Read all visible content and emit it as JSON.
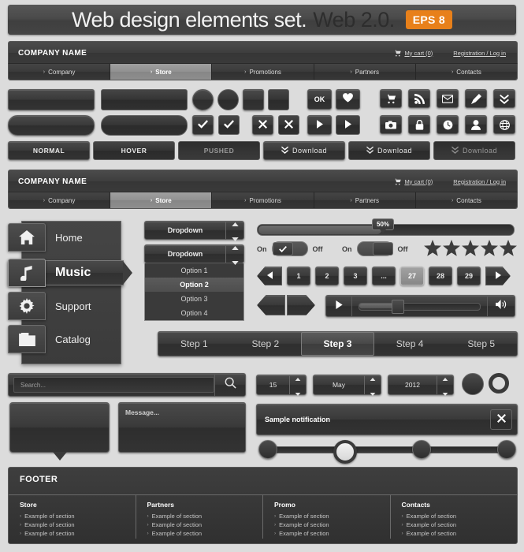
{
  "title_bar": {
    "main": "Web design elements set.",
    "sub": "Web 2.0.",
    "badge": "EPS 8",
    "badge_color": "#e8801a"
  },
  "header": {
    "company": "COMPANY NAME",
    "cart_label": "My cart (0)",
    "auth_label": "Registration / Log in",
    "cart_icon": "cart-icon"
  },
  "nav": {
    "items": [
      {
        "label": "Company",
        "active": false
      },
      {
        "label": "Store",
        "active": true
      },
      {
        "label": "Promotions",
        "active": false
      },
      {
        "label": "Partners",
        "active": false
      },
      {
        "label": "Contacts",
        "active": false
      }
    ],
    "chevron": "›"
  },
  "buttons": {
    "states": [
      {
        "label": "NORMAL",
        "state": "normal"
      },
      {
        "label": "HOVER",
        "state": "hover"
      },
      {
        "label": "PUSHED",
        "state": "pushed"
      }
    ],
    "download": [
      {
        "label": "Download",
        "state": "normal"
      },
      {
        "label": "Download",
        "state": "hover"
      },
      {
        "label": "Download",
        "state": "pushed"
      }
    ],
    "ok_label": "OK",
    "icons_row1": [
      "cart-icon",
      "rss-icon",
      "mail-icon",
      "pencil-icon",
      "double-chevron-down-icon"
    ],
    "icons_row2": [
      "camera-icon",
      "lock-icon",
      "clock-icon",
      "user-icon",
      "globe-icon"
    ],
    "heart_icon": "heart-icon",
    "check_icon": "check-icon",
    "close_icon": "close-icon",
    "play_icon": "play-icon"
  },
  "menu": {
    "items": [
      {
        "label": "Home",
        "icon": "home-icon",
        "selected": false
      },
      {
        "label": "Music",
        "icon": "music-note-icon",
        "selected": true
      },
      {
        "label": "Support",
        "icon": "gear-icon",
        "selected": false
      },
      {
        "label": "Catalog",
        "icon": "folder-icon",
        "selected": false
      }
    ]
  },
  "dropdown": {
    "label": "Dropdown",
    "options": [
      {
        "label": "Option 1",
        "selected": false
      },
      {
        "label": "Option 2",
        "selected": true
      },
      {
        "label": "Option 3",
        "selected": false
      },
      {
        "label": "Option 4",
        "selected": false
      }
    ]
  },
  "slider": {
    "value_label": "50%",
    "percent": 50
  },
  "toggles": [
    {
      "on_label": "On",
      "off_label": "Off",
      "checked": true
    },
    {
      "on_label": "On",
      "off_label": "Off",
      "checked": false
    }
  ],
  "rating": {
    "stars": 5,
    "filled": 5,
    "icon": "star-icon"
  },
  "pagination": {
    "prev_icon": "chevron-left-icon",
    "next_icon": "chevron-right-icon",
    "pages": [
      {
        "label": "1",
        "active": false
      },
      {
        "label": "2",
        "active": false
      },
      {
        "label": "3",
        "active": false
      },
      {
        "label": "...",
        "active": false
      },
      {
        "label": "27",
        "active": true
      },
      {
        "label": "28",
        "active": false
      },
      {
        "label": "29",
        "active": false
      }
    ]
  },
  "player": {
    "play_icon": "play-icon",
    "volume_icon": "volume-icon",
    "progress": 30
  },
  "steps": [
    {
      "label": "Step 1",
      "active": false
    },
    {
      "label": "Step 2",
      "active": false
    },
    {
      "label": "Step 3",
      "active": true
    },
    {
      "label": "Step 4",
      "active": false
    },
    {
      "label": "Step 5",
      "active": false
    }
  ],
  "search": {
    "placeholder": "Search...",
    "value": "",
    "icon": "search-icon"
  },
  "date_picker": {
    "day": "15",
    "month": "May",
    "year": "2012"
  },
  "textarea": {
    "placeholder": "Message...",
    "value": ""
  },
  "notification": {
    "text": "Sample notification",
    "close_icon": "close-icon"
  },
  "dot_slider": {
    "dots": [
      {
        "active": false
      },
      {
        "active": true
      },
      {
        "active": false
      },
      {
        "active": false
      }
    ]
  },
  "footer": {
    "title": "FOOTER",
    "columns": [
      {
        "heading": "Store",
        "links": [
          "Example of section",
          "Example of section",
          "Example of section"
        ]
      },
      {
        "heading": "Partners",
        "links": [
          "Example of section",
          "Example of section",
          "Example of section"
        ]
      },
      {
        "heading": "Promo",
        "links": [
          "Example of section",
          "Example of section",
          "Example of section"
        ]
      },
      {
        "heading": "Contacts",
        "links": [
          "Example of section",
          "Example of section",
          "Example of section"
        ]
      }
    ],
    "chevron": "›"
  },
  "colors": {
    "background": "#dcdcdc",
    "dark": "#3a3a3a",
    "accent": "#e8801a",
    "light_active": "#8e8e8e"
  }
}
